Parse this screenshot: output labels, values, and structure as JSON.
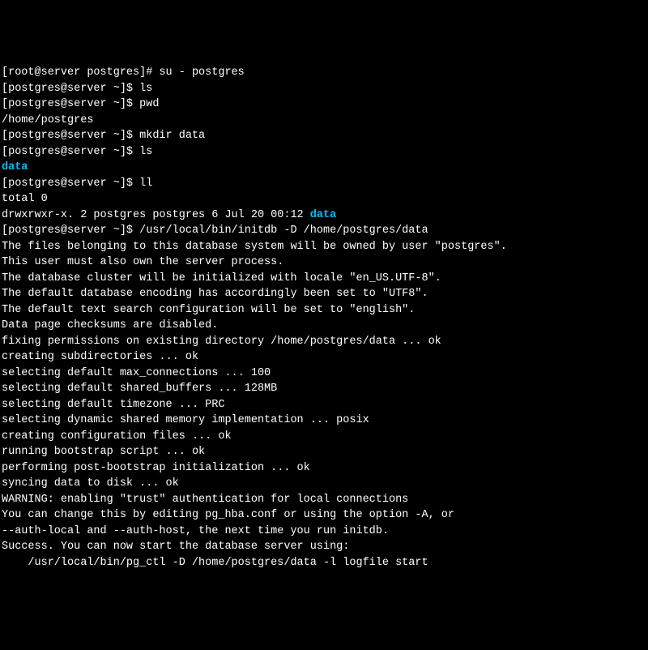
{
  "lines": [
    {
      "parts": [
        {
          "text": "[root@server postgres]# su - postgres"
        }
      ]
    },
    {
      "parts": [
        {
          "text": "[postgres@server ~]$ ls"
        }
      ]
    },
    {
      "parts": [
        {
          "text": "[postgres@server ~]$ pwd"
        }
      ]
    },
    {
      "parts": [
        {
          "text": "/home/postgres"
        }
      ]
    },
    {
      "parts": [
        {
          "text": "[postgres@server ~]$ mkdir data"
        }
      ]
    },
    {
      "parts": [
        {
          "text": "[postgres@server ~]$ ls"
        }
      ]
    },
    {
      "parts": [
        {
          "text": "data",
          "class": "cyan"
        }
      ]
    },
    {
      "parts": [
        {
          "text": "[postgres@server ~]$ ll"
        }
      ]
    },
    {
      "parts": [
        {
          "text": "total 0"
        }
      ]
    },
    {
      "parts": [
        {
          "text": "drwxrwxr-x. 2 postgres postgres 6 Jul 20 00:12 "
        },
        {
          "text": "data",
          "class": "cyan"
        }
      ]
    },
    {
      "parts": [
        {
          "text": "[postgres@server ~]$ /usr/local/bin/initdb -D /home/postgres/data"
        }
      ]
    },
    {
      "parts": [
        {
          "text": "The files belonging to this database system will be owned by user \"postgres\"."
        }
      ]
    },
    {
      "parts": [
        {
          "text": "This user must also own the server process."
        }
      ]
    },
    {
      "parts": [
        {
          "text": ""
        }
      ]
    },
    {
      "parts": [
        {
          "text": "The database cluster will be initialized with locale \"en_US.UTF-8\"."
        }
      ]
    },
    {
      "parts": [
        {
          "text": "The default database encoding has accordingly been set to \"UTF8\"."
        }
      ]
    },
    {
      "parts": [
        {
          "text": "The default text search configuration will be set to \"english\"."
        }
      ]
    },
    {
      "parts": [
        {
          "text": ""
        }
      ]
    },
    {
      "parts": [
        {
          "text": "Data page checksums are disabled."
        }
      ]
    },
    {
      "parts": [
        {
          "text": ""
        }
      ]
    },
    {
      "parts": [
        {
          "text": "fixing permissions on existing directory /home/postgres/data ... ok"
        }
      ]
    },
    {
      "parts": [
        {
          "text": "creating subdirectories ... ok"
        }
      ]
    },
    {
      "parts": [
        {
          "text": "selecting default max_connections ... 100"
        }
      ]
    },
    {
      "parts": [
        {
          "text": "selecting default shared_buffers ... 128MB"
        }
      ]
    },
    {
      "parts": [
        {
          "text": "selecting default timezone ... PRC"
        }
      ]
    },
    {
      "parts": [
        {
          "text": "selecting dynamic shared memory implementation ... posix"
        }
      ]
    },
    {
      "parts": [
        {
          "text": "creating configuration files ... ok"
        }
      ]
    },
    {
      "parts": [
        {
          "text": "running bootstrap script ... ok"
        }
      ]
    },
    {
      "parts": [
        {
          "text": "performing post-bootstrap initialization ... ok"
        }
      ]
    },
    {
      "parts": [
        {
          "text": "syncing data to disk ... ok"
        }
      ]
    },
    {
      "parts": [
        {
          "text": ""
        }
      ]
    },
    {
      "parts": [
        {
          "text": "WARNING: enabling \"trust\" authentication for local connections"
        }
      ]
    },
    {
      "parts": [
        {
          "text": "You can change this by editing pg_hba.conf or using the option -A, or"
        }
      ]
    },
    {
      "parts": [
        {
          "text": "--auth-local and --auth-host, the next time you run initdb."
        }
      ]
    },
    {
      "parts": [
        {
          "text": ""
        }
      ]
    },
    {
      "parts": [
        {
          "text": "Success. You can now start the database server using:"
        }
      ]
    },
    {
      "parts": [
        {
          "text": ""
        }
      ]
    },
    {
      "parts": [
        {
          "text": "    /usr/local/bin/pg_ctl -D /home/postgres/data -l logfile start"
        }
      ]
    },
    {
      "parts": [
        {
          "text": ""
        }
      ]
    }
  ]
}
